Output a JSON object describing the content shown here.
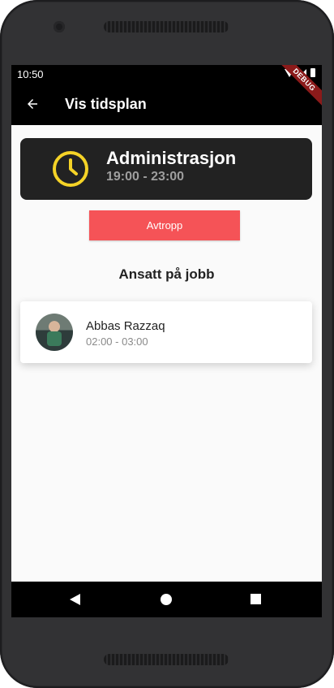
{
  "status_bar": {
    "time": "10:50",
    "debug_label": "DEBUG"
  },
  "app_bar": {
    "title": "Vis tidsplan",
    "back_icon": "arrow-back-icon"
  },
  "shift": {
    "name": "Administrasjon",
    "time": "19:00 - 23:00",
    "icon": "clock-icon",
    "icon_color": "#f5d327",
    "card_color": "#222222"
  },
  "checkout_button": {
    "label": "Avtropp",
    "color": "#f55357"
  },
  "section": {
    "heading": "Ansatt på jobb"
  },
  "employees": [
    {
      "name": "Abbas Razzaq",
      "shift": "02:00 - 03:00"
    }
  ],
  "nav_bar": {
    "icons": [
      "nav-back-icon",
      "nav-home-icon",
      "nav-recents-icon"
    ]
  }
}
